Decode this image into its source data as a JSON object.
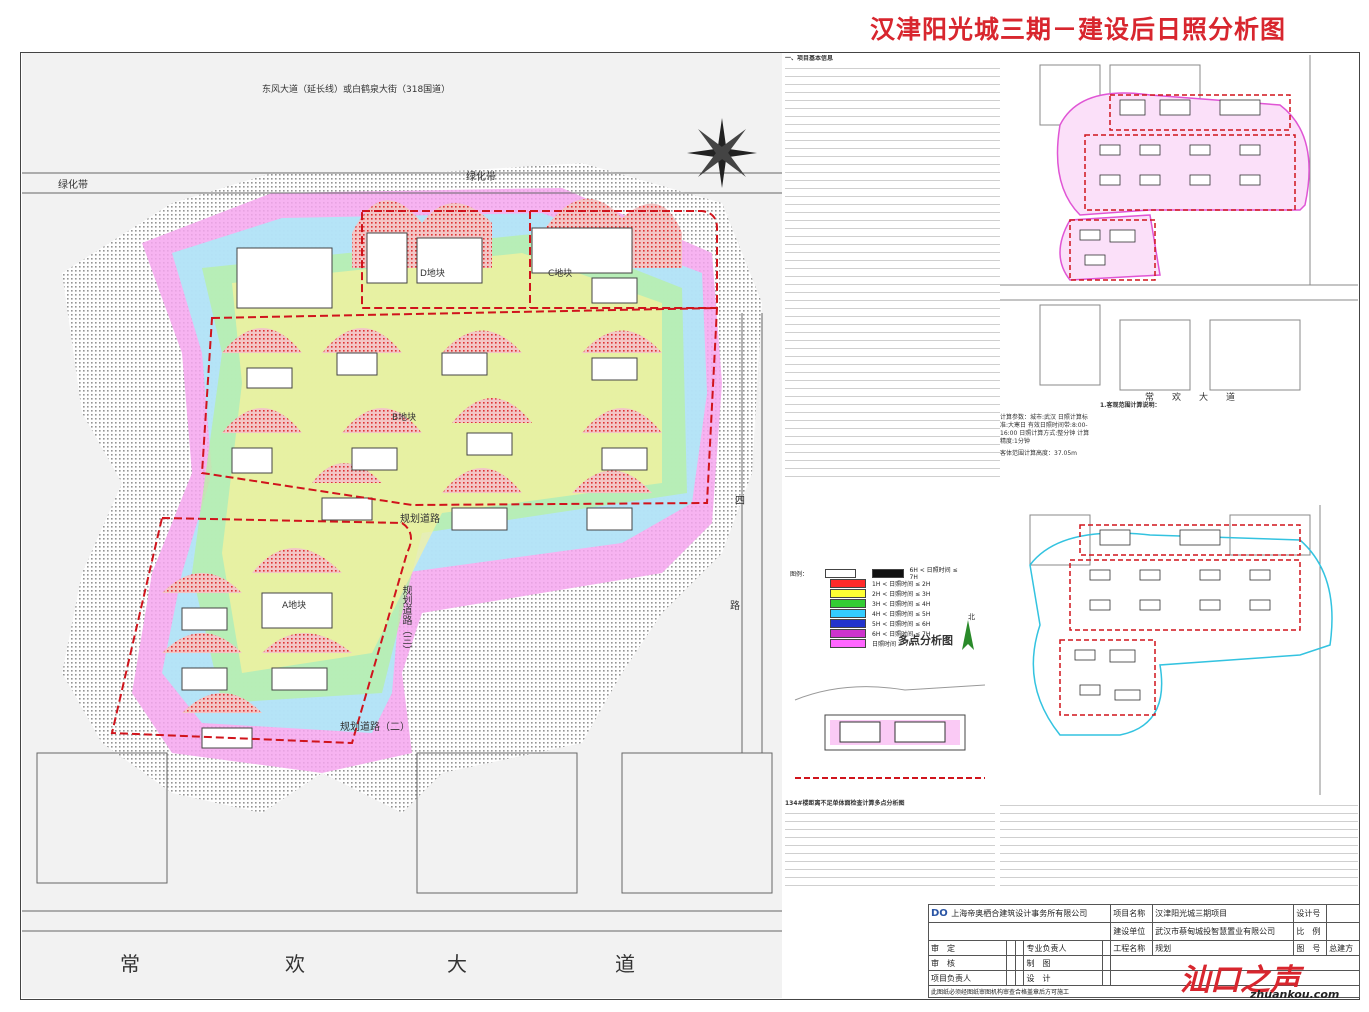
{
  "title": "汉津阳光城三期－建设后日照分析图",
  "map": {
    "road_north_label": "东风大道（延长线）或白鹤泉大街（318国道）",
    "green_belt_left": "绿化带",
    "green_belt_top": "绿化带",
    "plot_d": "D地块",
    "plot_c": "C地块",
    "plot_b": "B地块",
    "plot_a": "A地块",
    "road_south_big": [
      "常",
      "欢",
      "大",
      "道"
    ],
    "road_planned": "规划道路（二）",
    "road_mid": "规划道路",
    "road_east_chars": [
      "四",
      "路"
    ],
    "road_right_planned": "规划道路（三）"
  },
  "legend": {
    "items": [
      {
        "label": "图例：",
        "color": "#ffffff"
      },
      {
        "label": "1H < 日照时间 ≤ 2H",
        "color": "#ff2a2a"
      },
      {
        "label": "2H < 日照时间 ≤ 3H",
        "color": "#ffff33"
      },
      {
        "label": "3H < 日照时间 ≤ 4H",
        "color": "#33cc33"
      },
      {
        "label": "4H < 日照时间 ≤ 5H",
        "color": "#33ccff"
      },
      {
        "label": "5H < 日照时间 ≤ 6H",
        "color": "#2233cc"
      },
      {
        "label": "6H < 日照时间 ≤ 7H",
        "color": "#cc33cc"
      },
      {
        "label": "日照时间 > 7H",
        "color": "#ff66ff"
      }
    ],
    "extra": [
      {
        "label": "6H < 日照时间 ≤ 7H",
        "color": "#111111"
      },
      {
        "label": "7H < 日照时间 ≤ 8H",
        "color": "#ffffff"
      }
    ]
  },
  "multi_point_label": "多点分析图",
  "north_label": "北",
  "mini_map_road": "常　　欢　　大　　道",
  "notes": {
    "heading_left": "一、项目基本信息",
    "right_heading": "1.客观范围计算说明：",
    "calc_params": "计算参数：城市:武汉 日照计算标准:大寒日 有效日照时间带:8:00-16:00 日照计算方式:整分钟 计算精度:1分钟",
    "height": "客体范围计算高度：37.05m",
    "bottom_left_heading": "134#楼距离不足单体面检查计算多点分析图"
  },
  "title_block": {
    "company": "上海帝奥栖合建筑设计事务所有限公司",
    "project_label": "项目名称",
    "project": "汉津阳光城三期项目",
    "client_label": "建设单位",
    "client": "武汉市蔡甸城投智慧置业有限公司",
    "role_approve": "审　定",
    "role_review": "审　核",
    "role_pm": "项目负责人",
    "role_major": "专业负责人",
    "role_draw": "制　图",
    "role_design": "设　计",
    "design_no_label": "设计号",
    "scale_label": "比　例",
    "eng_no_label": "工程名称",
    "drawing_label": "图　号",
    "drawing_value": "总建方",
    "stage_label": "规划",
    "footnote": "此图纸必须经图纸审图机构审查合格盖章后方可施工"
  },
  "watermark": {
    "main": "汕口之声",
    "sub": "zhuankou.com"
  }
}
